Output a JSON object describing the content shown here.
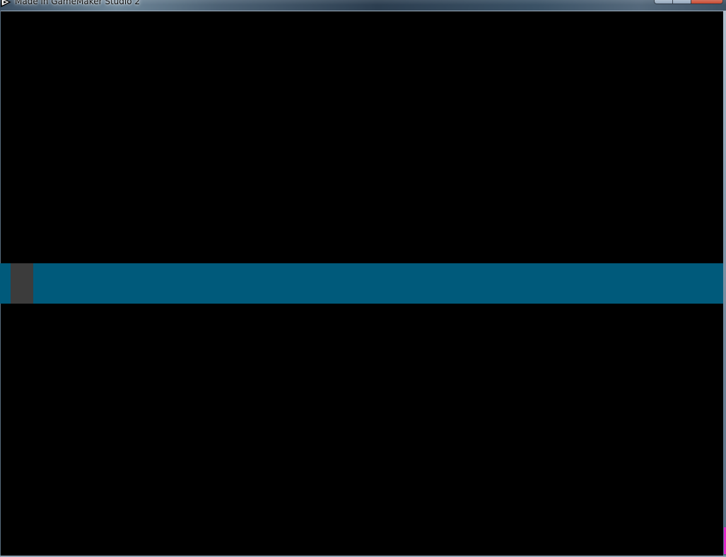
{
  "window": {
    "title": "Made in GameMaker Studio 2",
    "caption_buttons": [
      "minimize",
      "maximize",
      "close"
    ]
  },
  "icons": {
    "app_icon": "gamemaker-icon"
  },
  "game": {
    "background_color": "#000000",
    "band_color": "#005a7b",
    "player_color": "#3c3c3c"
  }
}
